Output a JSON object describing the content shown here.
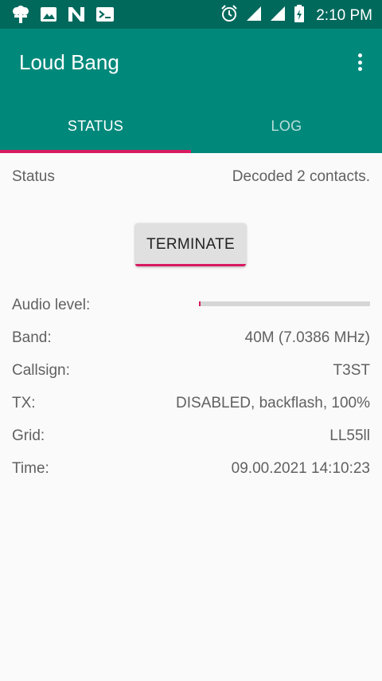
{
  "status_bar": {
    "time": "2:10 PM",
    "left_icons": [
      "tree-icon",
      "image-icon",
      "n-icon",
      "terminal-icon"
    ],
    "right_icons": [
      "alarm-icon",
      "signal-icon",
      "signal-icon",
      "battery-icon"
    ]
  },
  "app_bar": {
    "title": "Loud Bang",
    "overflow_icon": "more-vert-icon",
    "color": "#00897b",
    "status_color": "#00695c",
    "accent": "#d81b60"
  },
  "tabs": [
    {
      "label": "STATUS",
      "active": true
    },
    {
      "label": "LOG",
      "active": false
    }
  ],
  "status": {
    "label": "Status",
    "value": "Decoded 2 contacts."
  },
  "terminate_button": {
    "label": "TERMINATE"
  },
  "audio_level": {
    "label": "Audio level:",
    "fraction": 0.005
  },
  "details": [
    {
      "label": "Band:",
      "value": "40M (7.0386 MHz)"
    },
    {
      "label": "Callsign:",
      "value": "T3ST"
    },
    {
      "label": "TX:",
      "value": "DISABLED, backflash, 100%"
    },
    {
      "label": "Grid:",
      "value": "LL55ll"
    },
    {
      "label": "Time:",
      "value": "09.00.2021 14:10:23"
    }
  ]
}
